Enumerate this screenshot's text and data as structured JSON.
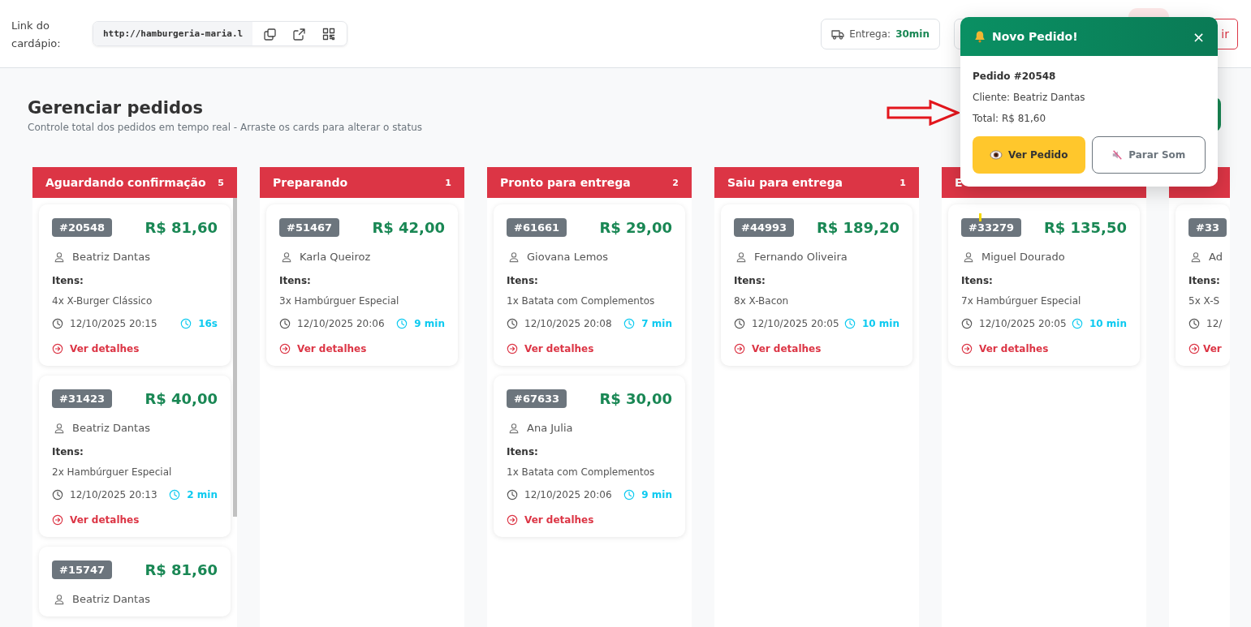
{
  "header": {
    "menu_link": {
      "label": "Link do cardápio:",
      "url": "http://hamburgeria-maria.l"
    },
    "delivery": {
      "label": "Entrega:",
      "value": "30min"
    },
    "exit_button": {
      "label": "ir"
    }
  },
  "page": {
    "title": "Gerenciar pedidos",
    "subtitle": "Controle total dos pedidos em tempo real - Arraste os cards para alterar o status"
  },
  "columns": [
    {
      "kind": "full",
      "title": "Aguardando confirmação",
      "count": "5",
      "orders": [
        {
          "id": "#20548",
          "total": "R$ 81,60",
          "customer": "Beatriz Dantas",
          "items_label": "Itens:",
          "items": "4x X-Burger Clássico",
          "datetime": "12/10/2025 20:15",
          "elapsed": "16s",
          "details": "Ver detalhes"
        },
        {
          "id": "#31423",
          "total": "R$ 40,00",
          "customer": "Beatriz Dantas",
          "items_label": "Itens:",
          "items": "2x Hambúrguer Especial",
          "datetime": "12/10/2025 20:13",
          "elapsed": "2 min",
          "details": "Ver detalhes"
        },
        {
          "id": "#15747",
          "total": "R$ 81,60",
          "customer": "Beatriz Dantas"
        }
      ]
    },
    {
      "kind": "full",
      "title": "Preparando",
      "count": "1",
      "orders": [
        {
          "id": "#51467",
          "total": "R$ 42,00",
          "customer": "Karla Queiroz",
          "items_label": "Itens:",
          "items": "3x Hambúrguer Especial",
          "datetime": "12/10/2025 20:06",
          "elapsed": "9 min",
          "details": "Ver detalhes"
        }
      ]
    },
    {
      "kind": "full",
      "title": "Pronto para entrega",
      "count": "2",
      "orders": [
        {
          "id": "#61661",
          "total": "R$ 29,00",
          "customer": "Giovana Lemos",
          "items_label": "Itens:",
          "items": "1x Batata com Complementos",
          "datetime": "12/10/2025 20:08",
          "elapsed": "7 min",
          "details": "Ver detalhes"
        },
        {
          "id": "#67633",
          "total": "R$ 30,00",
          "customer": "Ana Julia",
          "items_label": "Itens:",
          "items": "1x Batata com Complementos",
          "datetime": "12/10/2025 20:06",
          "elapsed": "9 min",
          "details": "Ver detalhes"
        }
      ]
    },
    {
      "kind": "full",
      "title": "Saiu para entrega",
      "count": "1",
      "orders": [
        {
          "id": "#44993",
          "total": "R$ 189,20",
          "customer": "Fernando Oliveira",
          "items_label": "Itens:",
          "items": "8x X-Bacon",
          "datetime": "12/10/2025 20:05",
          "elapsed": "10 min",
          "details": "Ver detalhes"
        }
      ]
    },
    {
      "kind": "full",
      "title": "E",
      "orders": [
        {
          "id": "#33279",
          "total": "R$ 135,50",
          "customer": "Miguel Dourado",
          "items_label": "Itens:",
          "items": "7x Hambúrguer Especial",
          "datetime": "12/10/2025 20:05",
          "elapsed": "10 min",
          "details": "Ver detalhes"
        }
      ]
    },
    {
      "kind": "partial",
      "orders": [
        {
          "id": "#33",
          "customer": "Ad",
          "items_label": "Itens:",
          "items": "5x X-S",
          "datetime": "12/",
          "details": "Ver"
        }
      ]
    }
  ],
  "notification": {
    "title": "Novo Pedido!",
    "close": "×",
    "order": "Pedido #20548",
    "customer": "Cliente: Beatriz Dantas",
    "total": "Total: R$ 81,60",
    "buttons": [
      {
        "kind": "primary",
        "label": "Ver Pedido"
      },
      {
        "kind": "secondary",
        "label": "Parar Som"
      }
    ]
  }
}
